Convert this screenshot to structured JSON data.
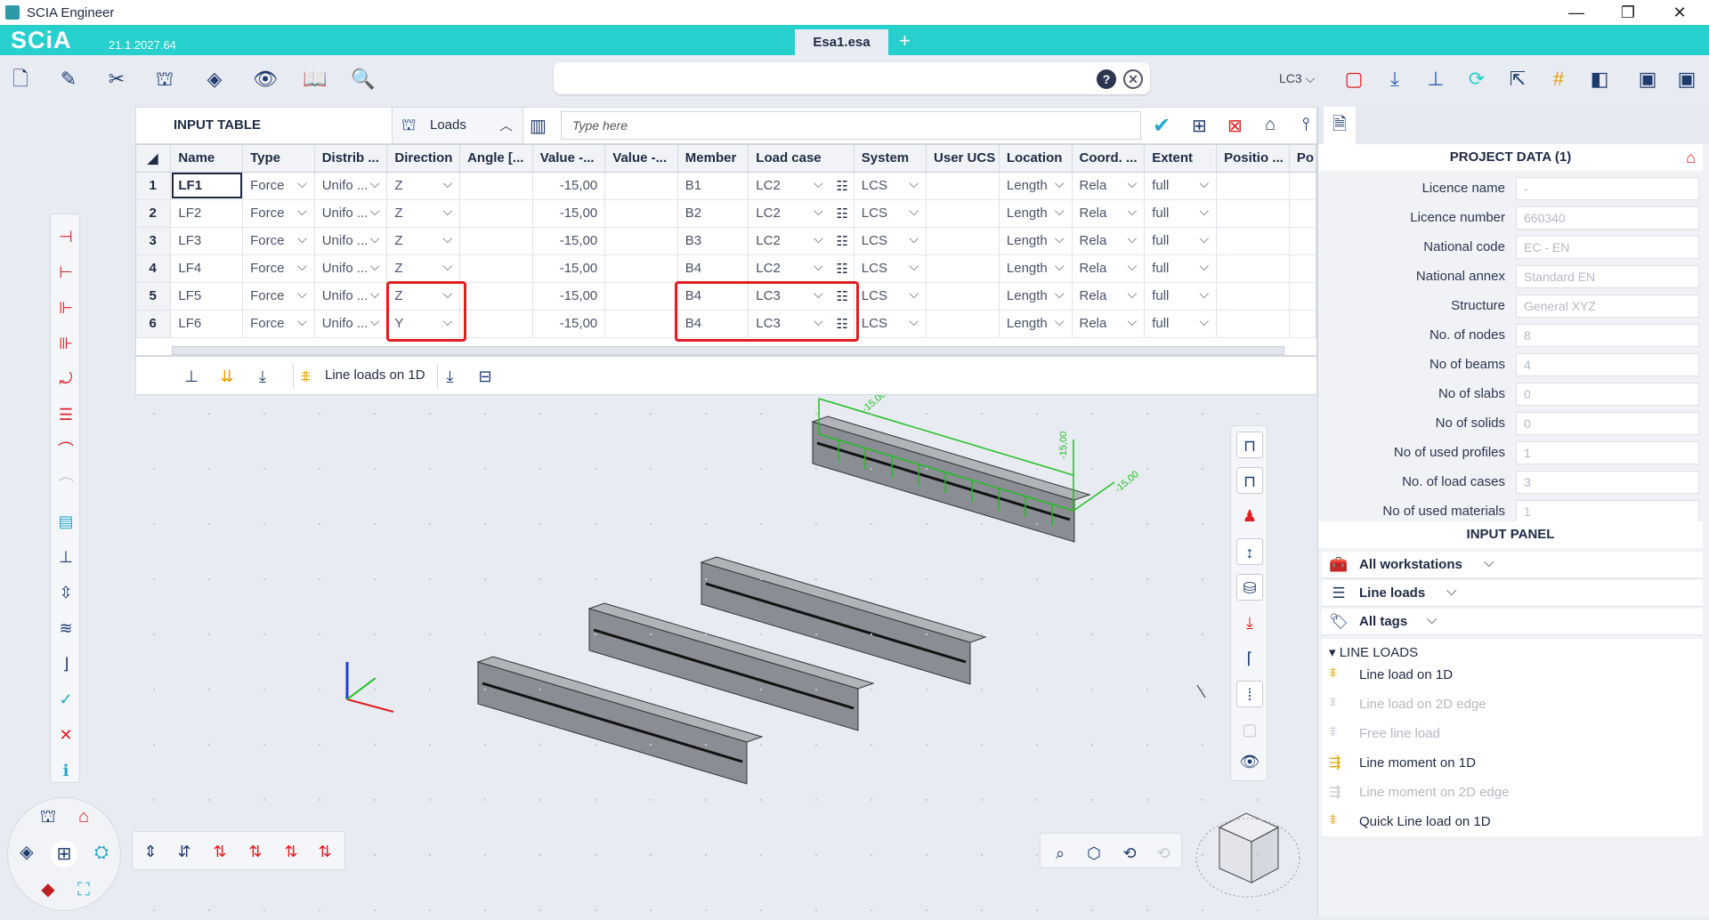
{
  "window": {
    "title": "SCIA Engineer"
  },
  "header": {
    "logo": "SCiA",
    "version": "21.1.2027.64",
    "doc_tab": "Esa1.esa",
    "add_tab": "+"
  },
  "toolbar": {
    "load_case": "LC3"
  },
  "search": {
    "help": "?",
    "close": "⊗"
  },
  "input_table": {
    "title": "INPUT TABLE",
    "category": "Loads",
    "filter_placeholder": "Type here",
    "columns": [
      "Name",
      "Type",
      "Distrib ...",
      "Direction",
      "Angle [...",
      "Value -...",
      "Value -...",
      "Member",
      "Load case",
      "System",
      "User UCS",
      "Location",
      "Coord. ...",
      "Extent",
      "Positio ...",
      "Po"
    ],
    "rows": [
      {
        "n": "1",
        "name": "LF1",
        "type": "Force",
        "distrib": "Unifo ...",
        "direction": "Z",
        "value": "-15,00",
        "member": "B1",
        "load_case": "LC2",
        "system": "LCS",
        "location": "Length",
        "coord": "Rela",
        "extent": "full"
      },
      {
        "n": "2",
        "name": "LF2",
        "type": "Force",
        "distrib": "Unifo ...",
        "direction": "Z",
        "value": "-15,00",
        "member": "B2",
        "load_case": "LC2",
        "system": "LCS",
        "location": "Length",
        "coord": "Rela",
        "extent": "full"
      },
      {
        "n": "3",
        "name": "LF3",
        "type": "Force",
        "distrib": "Unifo ...",
        "direction": "Z",
        "value": "-15,00",
        "member": "B3",
        "load_case": "LC2",
        "system": "LCS",
        "location": "Length",
        "coord": "Rela",
        "extent": "full"
      },
      {
        "n": "4",
        "name": "LF4",
        "type": "Force",
        "distrib": "Unifo ...",
        "direction": "Z",
        "value": "-15,00",
        "member": "B4",
        "load_case": "LC2",
        "system": "LCS",
        "location": "Length",
        "coord": "Rela",
        "extent": "full"
      },
      {
        "n": "5",
        "name": "LF5",
        "type": "Force",
        "distrib": "Unifo ...",
        "direction": "Z",
        "value": "-15,00",
        "member": "B4",
        "load_case": "LC3",
        "system": "LCS",
        "location": "Length",
        "coord": "Rela",
        "extent": "full"
      },
      {
        "n": "6",
        "name": "LF6",
        "type": "Force",
        "distrib": "Unifo ...",
        "direction": "Y",
        "value": "-15,00",
        "member": "B4",
        "load_case": "LC3",
        "system": "LCS",
        "location": "Length",
        "coord": "Rela",
        "extent": "full"
      }
    ]
  },
  "bottom_strip": {
    "active_label": "Line loads on 1D"
  },
  "viewport": {
    "load_labels": [
      "-15,00",
      "-15,00",
      "-15,00"
    ]
  },
  "project_data": {
    "title": "PROJECT DATA (1)",
    "rows": [
      {
        "label": "Licence name",
        "value": "-"
      },
      {
        "label": "Licence number",
        "value": "660340"
      },
      {
        "label": "National code",
        "value": "EC - EN"
      },
      {
        "label": "National annex",
        "value": "Standard EN"
      },
      {
        "label": "Structure",
        "value": "General XYZ"
      },
      {
        "label": "No. of nodes",
        "value": "8"
      },
      {
        "label": "No of beams",
        "value": "4"
      },
      {
        "label": "No of slabs",
        "value": "0"
      },
      {
        "label": "No of solids",
        "value": "0"
      },
      {
        "label": "No of used profiles",
        "value": "1"
      },
      {
        "label": "No. of load cases",
        "value": "3"
      },
      {
        "label": "No of used materials",
        "value": "1"
      }
    ]
  },
  "input_panel": {
    "title": "INPUT PANEL",
    "filters": [
      "All workstations",
      "Line loads",
      "All tags"
    ],
    "group": "LINE LOADS",
    "items": [
      {
        "label": "Line load on 1D",
        "enabled": true
      },
      {
        "label": "Line load on 2D edge",
        "enabled": false
      },
      {
        "label": "Free line load",
        "enabled": false
      },
      {
        "label": "Line moment on 1D",
        "enabled": true
      },
      {
        "label": "Line moment on 2D edge",
        "enabled": false
      },
      {
        "label": "Quick Line load on 1D",
        "enabled": true
      }
    ]
  },
  "colors": {
    "accent": "#27cfcd",
    "highlight": "#e01e22",
    "load": "#1fbf1f",
    "icon": "#1f3b6e"
  }
}
